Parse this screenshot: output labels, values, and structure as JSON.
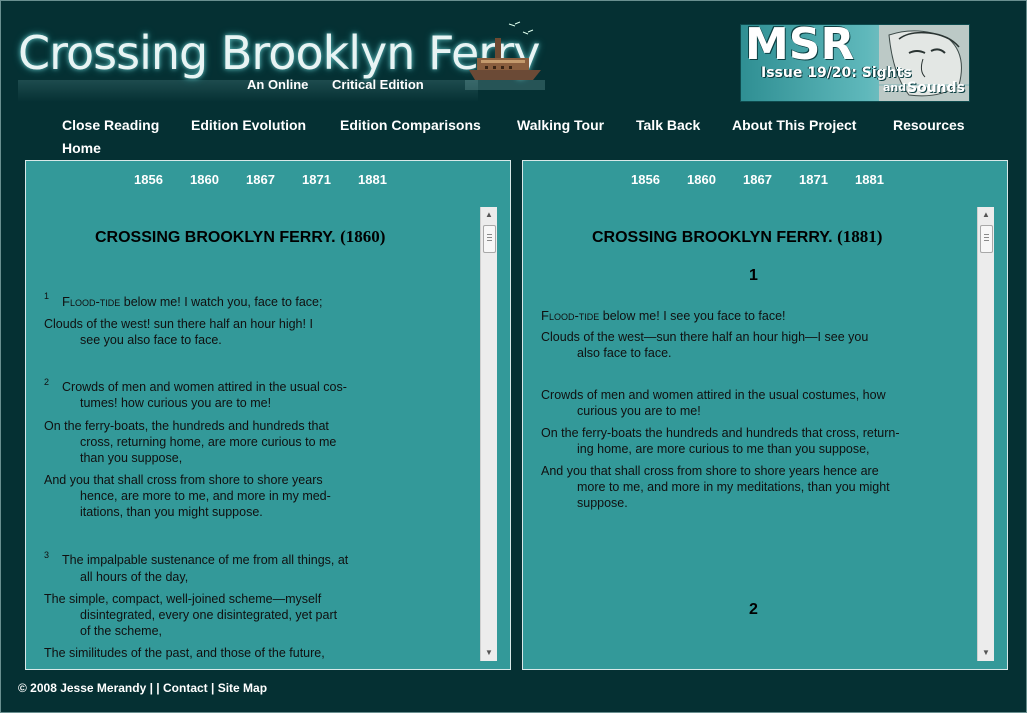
{
  "header": {
    "title": "Crossing Brooklyn Ferry",
    "subtitle_part1": "An Online",
    "subtitle_part2": "Critical Edition",
    "msr_logo": {
      "acronym": "MSR",
      "issue": "Issue 19/20: Sights",
      "and": "and",
      "sounds": "Sounds"
    },
    "ferry_icon": "ferryboat-illustration"
  },
  "nav": {
    "items": [
      "Close Reading",
      "Edition Evolution",
      "Edition Comparisons",
      "Walking Tour",
      "Talk Back",
      "About This Project",
      "Resources",
      "Home"
    ]
  },
  "left_panel": {
    "years": [
      "1856",
      "1860",
      "1867",
      "1871",
      "1881"
    ],
    "title": "CROSSING BROOKLYN FERRY.",
    "title_year": "(1860)",
    "stanzas": [
      {
        "num": "1",
        "lines": [
          {
            "sc": "Flood-tide",
            "rest": " below me! I watch you, face to face;"
          },
          {
            "text": "Clouds of the west! sun there half an hour high! I",
            "cont": "see you also face to face."
          }
        ]
      },
      {
        "num": "2",
        "lines": [
          {
            "text": "Crowds of men and women attired in the usual cos-",
            "cont": "tumes! how curious you are to me!"
          },
          {
            "text": "On the ferry-boats, the hundreds and hundreds that",
            "cont": "cross, returning home, are more curious to me",
            "cont2": "than you suppose,"
          },
          {
            "text": "And you that shall cross from shore to shore years",
            "cont": "hence, are more to me, and more in my med-",
            "cont2": "itations, than you might suppose."
          }
        ]
      },
      {
        "num": "3",
        "lines": [
          {
            "text": "The impalpable sustenance of me from all things, at",
            "cont": "all hours of the day,"
          },
          {
            "text": "The simple, compact, well-joined scheme—myself",
            "cont": "disintegrated, every one disintegrated, yet part",
            "cont2": "of the scheme,"
          },
          {
            "text": "The similitudes of the past, and those of the future,"
          }
        ]
      }
    ]
  },
  "right_panel": {
    "years": [
      "1856",
      "1860",
      "1867",
      "1871",
      "1881"
    ],
    "title": "CROSSING BROOKLYN FERRY.",
    "title_year": "(1881)",
    "sections": [
      "1",
      "2"
    ],
    "lines": [
      {
        "sc": "Flood-tide",
        "rest": " below me! I see you face to face!"
      },
      {
        "text": "Clouds of the west—sun there half an hour high—I see you",
        "cont": "also face to face."
      },
      {
        "text": "Crowds of men and women attired in the usual costumes, how",
        "cont": "curious you are to me!"
      },
      {
        "text": "On the ferry-boats the hundreds and hundreds that cross, return-",
        "cont": "ing home, are more curious to me than you suppose,"
      },
      {
        "text": "And you that shall cross from shore to shore years hence are",
        "cont": "more to me, and more in my meditations, than you might",
        "cont2": "suppose."
      }
    ]
  },
  "footer": {
    "copyright": "© 2008 Jesse Merandy |",
    "sep": "|",
    "contact": "Contact",
    "sep2": "|",
    "sitemap": "Site Map"
  },
  "colors": {
    "background": "#053033",
    "panel": "#339999",
    "text_light": "#ffffff"
  }
}
